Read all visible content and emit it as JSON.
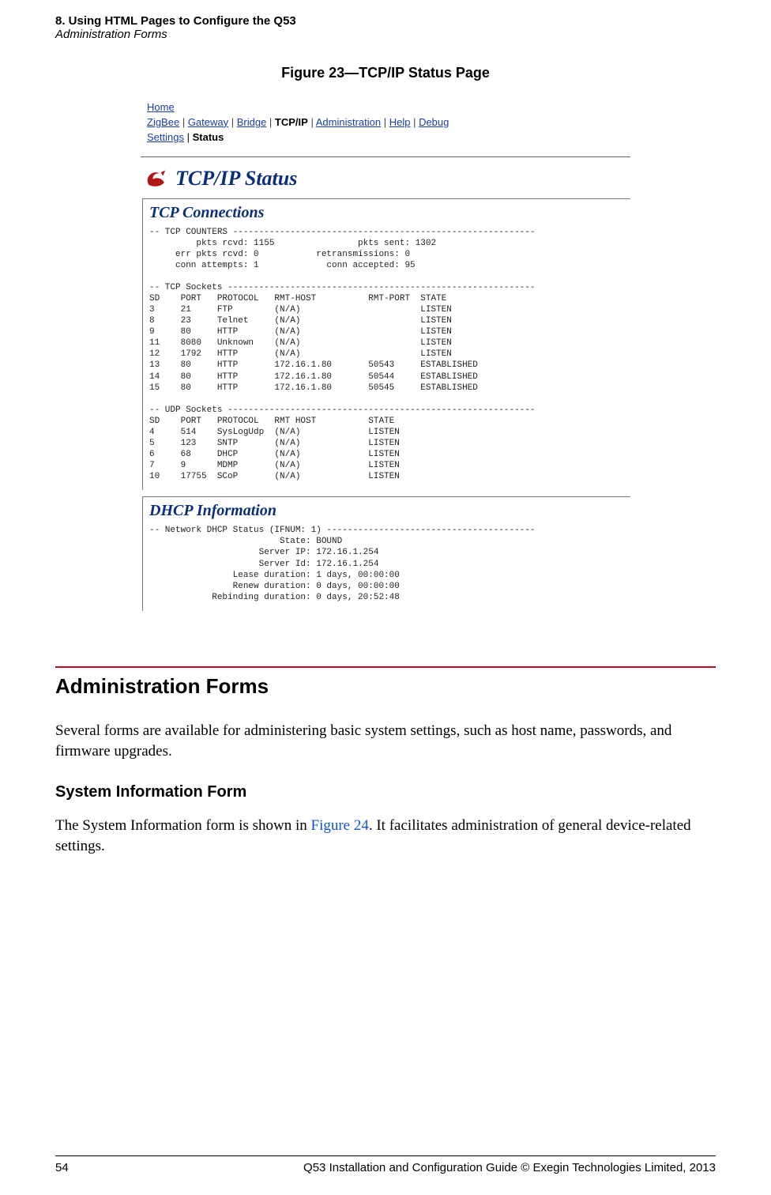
{
  "header": {
    "chapter": "8. Using HTML Pages to Configure the Q53",
    "subtitle": "Administration Forms"
  },
  "figure": {
    "caption": "Figure 23—TCP/IP Status Page"
  },
  "shot": {
    "nav": {
      "home": "Home",
      "crumbs": [
        "ZigBee",
        "Gateway",
        "Bridge",
        "TCP/IP",
        "Administration",
        "Help",
        "Debug"
      ],
      "crumb_current_index": 3,
      "subnav": [
        "Settings",
        "Status"
      ],
      "subnav_current_index": 1
    },
    "title": "TCP/IP Status",
    "tcp": {
      "heading": "TCP Connections",
      "text": "-- TCP COUNTERS ----------------------------------------------------------\n         pkts rcvd: 1155                pkts sent: 1302\n     err pkts rcvd: 0           retransmissions: 0\n     conn attempts: 1             conn accepted: 95\n\n-- TCP Sockets -----------------------------------------------------------\nSD    PORT   PROTOCOL   RMT-HOST          RMT-PORT  STATE\n3     21     FTP        (N/A)                       LISTEN\n8     23     Telnet     (N/A)                       LISTEN\n9     80     HTTP       (N/A)                       LISTEN\n11    8080   Unknown    (N/A)                       LISTEN\n12    1792   HTTP       (N/A)                       LISTEN\n13    80     HTTP       172.16.1.80       50543     ESTABLISHED\n14    80     HTTP       172.16.1.80       50544     ESTABLISHED\n15    80     HTTP       172.16.1.80       50545     ESTABLISHED\n\n-- UDP Sockets -----------------------------------------------------------\nSD    PORT   PROTOCOL   RMT HOST          STATE\n4     514    SysLogUdp  (N/A)             LISTEN\n5     123    SNTP       (N/A)             LISTEN\n6     68     DHCP       (N/A)             LISTEN\n7     9      MDMP       (N/A)             LISTEN\n10    17755  SCoP       (N/A)             LISTEN"
    },
    "dhcp": {
      "heading": "DHCP Information",
      "text": "-- Network DHCP Status (IFNUM: 1) ----------------------------------------\n                         State: BOUND\n                     Server IP: 172.16.1.254\n                     Server Id: 172.16.1.254\n                Lease duration: 1 days, 00:00:00\n                Renew duration: 0 days, 00:00:00\n            Rebinding duration: 0 days, 20:52:48"
    }
  },
  "section": {
    "title": "Administration Forms",
    "para": "Several forms are available for administering basic system settings, such as host name, passwords, and firmware upgrades."
  },
  "subsection": {
    "title": "System Information Form",
    "para_pre": "The System Information form is shown in ",
    "xref": "Figure 24",
    "para_post": ". It facilitates administration of general device-related settings."
  },
  "footer": {
    "page": "54",
    "text": "Q53 Installation and Configuration Guide  © Exegin Technologies Limited, 2013"
  }
}
